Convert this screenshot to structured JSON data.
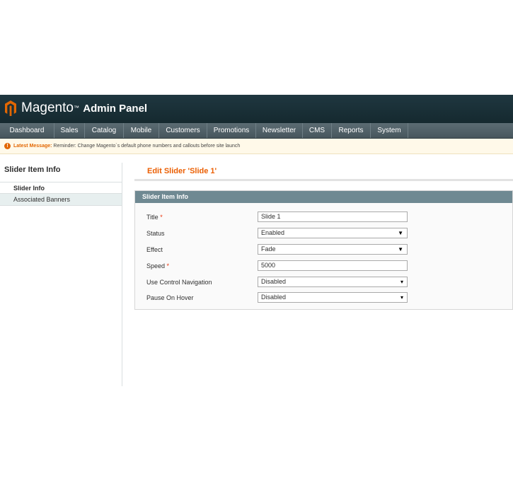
{
  "header": {
    "brand": "Magento",
    "tm": "™",
    "panel": "Admin Panel",
    "logo_color": "#e26703"
  },
  "nav": [
    "Dashboard",
    "Sales",
    "Catalog",
    "Mobile",
    "Customers",
    "Promotions",
    "Newsletter",
    "CMS",
    "Reports",
    "System"
  ],
  "message": {
    "label": "Latest Message:",
    "text": "Reminder: Change Magento`s default phone numbers and callouts before site launch"
  },
  "sidebar": {
    "title": "Slider Item Info",
    "tabs": [
      "Slider Info",
      "Associated Banners"
    ]
  },
  "page": {
    "title": "Edit Slider 'Slide 1'"
  },
  "form": {
    "legend": "Slider Item Info",
    "required_mark": "*",
    "fields": [
      {
        "label": "Title",
        "value": "Slide 1",
        "type": "input",
        "required": true
      },
      {
        "label": "Status",
        "value": "Enabled",
        "type": "select",
        "required": false,
        "arrow": "▼"
      },
      {
        "label": "Effect",
        "value": "Fade",
        "type": "select",
        "required": false,
        "arrow": "▼"
      },
      {
        "label": "Speed",
        "value": "5000",
        "type": "input",
        "required": true
      },
      {
        "label": "Use Control Navigation",
        "value": "Disabled",
        "type": "select",
        "required": false,
        "arrow": "▾"
      },
      {
        "label": "Pause On Hover",
        "value": "Disabled",
        "type": "select",
        "required": false,
        "arrow": "▾"
      }
    ]
  }
}
